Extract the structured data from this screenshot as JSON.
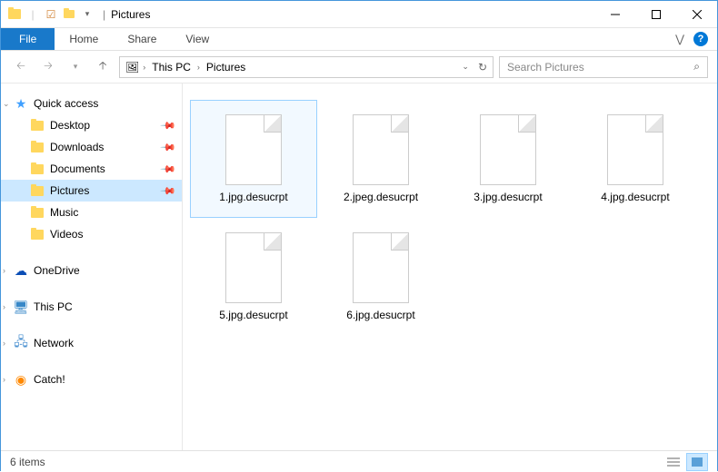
{
  "window": {
    "title": "Pictures"
  },
  "ribbon": {
    "file": "File",
    "tabs": [
      "Home",
      "Share",
      "View"
    ]
  },
  "breadcrumb": {
    "items": [
      "This PC",
      "Pictures"
    ]
  },
  "search": {
    "placeholder": "Search Pictures"
  },
  "sidebar": {
    "quick_access": {
      "label": "Quick access",
      "items": [
        {
          "label": "Desktop",
          "pinned": true
        },
        {
          "label": "Downloads",
          "pinned": true
        },
        {
          "label": "Documents",
          "pinned": true
        },
        {
          "label": "Pictures",
          "pinned": true,
          "selected": true
        },
        {
          "label": "Music",
          "pinned": false
        },
        {
          "label": "Videos",
          "pinned": false
        }
      ]
    },
    "roots": [
      {
        "label": "OneDrive",
        "icon": "cloud"
      },
      {
        "label": "This PC",
        "icon": "monitor"
      },
      {
        "label": "Network",
        "icon": "network"
      },
      {
        "label": "Catch!",
        "icon": "catch"
      }
    ]
  },
  "files": [
    {
      "name": "1.jpg.desucrpt",
      "selected": true
    },
    {
      "name": "2.jpeg.desucrpt"
    },
    {
      "name": "3.jpg.desucrpt"
    },
    {
      "name": "4.jpg.desucrpt"
    },
    {
      "name": "5.jpg.desucrpt"
    },
    {
      "name": "6.jpg.desucrpt"
    }
  ],
  "status": {
    "count": "6 items"
  }
}
